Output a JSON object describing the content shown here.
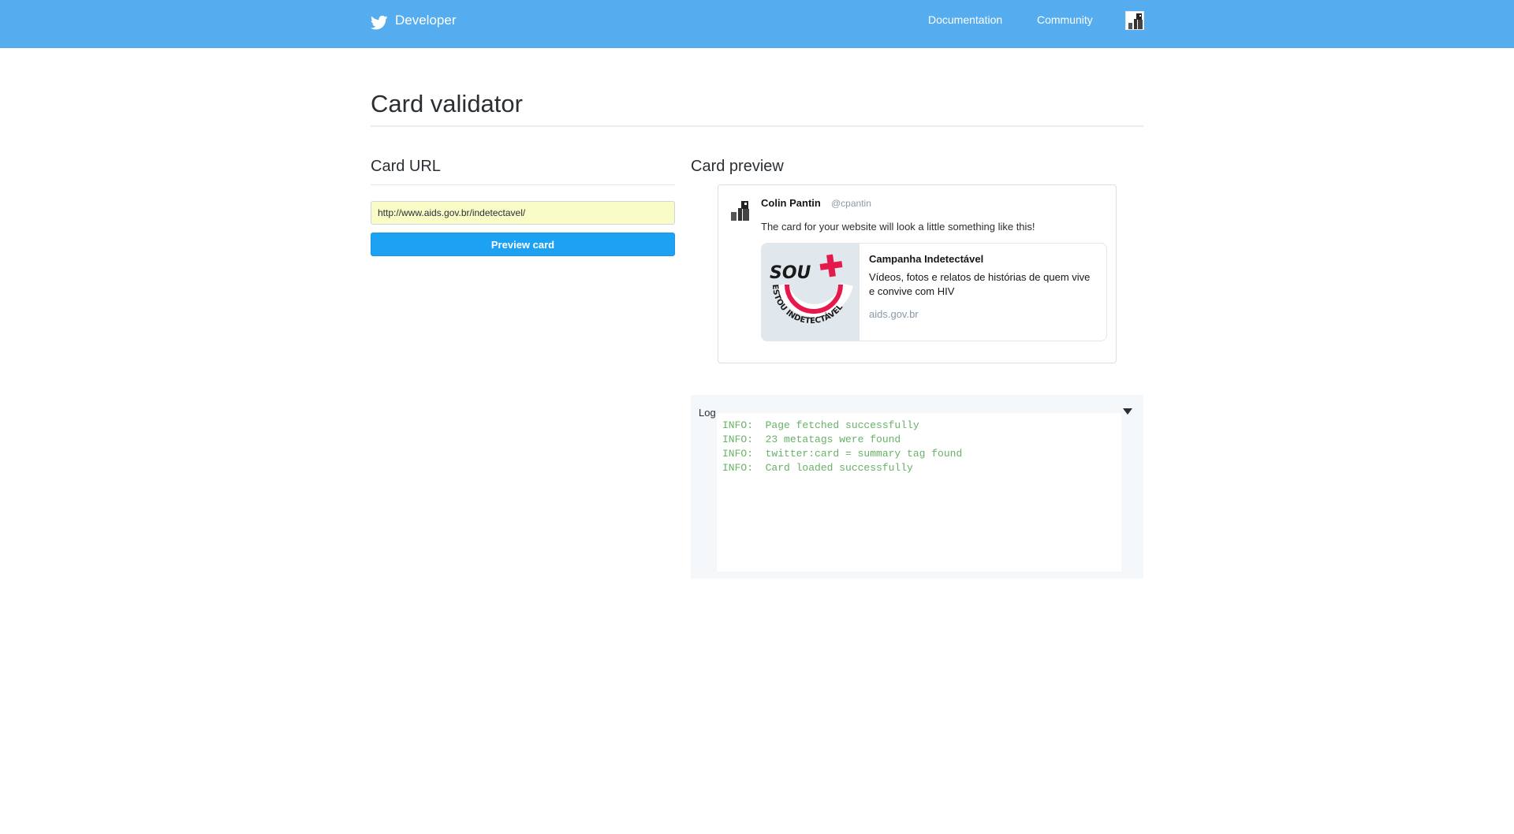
{
  "header": {
    "brand_label": "Developer",
    "nav": {
      "documentation": "Documentation",
      "community": "Community"
    },
    "icons": {
      "brand": "twitter-bird-icon",
      "avatar": "user-avatar"
    },
    "color": "#55acee"
  },
  "page": {
    "title": "Card validator"
  },
  "card_url": {
    "heading": "Card URL",
    "input_value": "http://www.aids.gov.br/indetectavel/",
    "button_label": "Preview card",
    "button_color": "#1da1f2"
  },
  "card_preview": {
    "heading": "Card preview",
    "tweet": {
      "author_name": "Colin Pantin",
      "author_handle": "@cpantin",
      "text": "The card for your website will look a little something like this!"
    },
    "card": {
      "logo_text_main": "SOU",
      "logo_text_arc": "ESTOU INDETECTÁVEL",
      "title": "Campanha Indetectável",
      "description": "Vídeos, fotos e relatos de histórias de quem vive e convive com HIV",
      "domain": "aids.gov.br"
    }
  },
  "log": {
    "label": "Log",
    "lines": [
      "INFO:  Page fetched successfully",
      "INFO:  23 metatags were found",
      "INFO:  twitter:card = summary tag found",
      "INFO:  Card loaded successfully"
    ],
    "line_color": "#67b266"
  }
}
